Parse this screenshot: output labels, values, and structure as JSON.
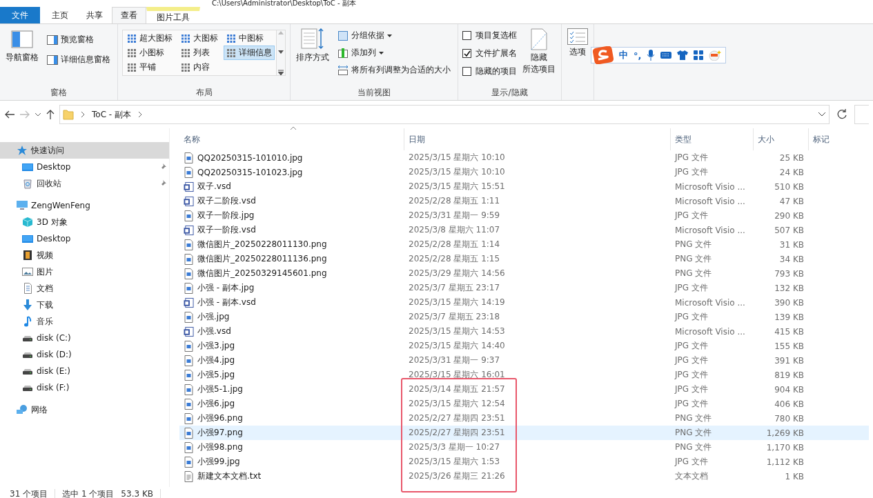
{
  "window": {
    "title": "C:\\Users\\Administrator\\Desktop\\ToC - 副本"
  },
  "ribbon_tabs": [
    {
      "label": "文件",
      "kind": "file",
      "selected": false
    },
    {
      "label": "主页",
      "kind": "tab",
      "selected": false
    },
    {
      "label": "共享",
      "kind": "tab",
      "selected": false
    },
    {
      "label": "查看",
      "kind": "tab",
      "selected": true
    },
    {
      "label": "图片工具",
      "kind": "context",
      "selected": false
    }
  ],
  "ribbon": {
    "pane_group": {
      "label": "窗格",
      "nav_pane": "导航窗格",
      "preview_pane": "预览窗格",
      "details_pane": "详细信息窗格"
    },
    "layout_group": {
      "label": "布局",
      "options": [
        {
          "label": "超大图标",
          "selected": false
        },
        {
          "label": "大图标",
          "selected": false
        },
        {
          "label": "中图标",
          "selected": false
        },
        {
          "label": "小图标",
          "selected": false
        },
        {
          "label": "列表",
          "selected": false
        },
        {
          "label": "详细信息",
          "selected": true
        },
        {
          "label": "平铺",
          "selected": false
        },
        {
          "label": "内容",
          "selected": false
        }
      ]
    },
    "view_group": {
      "label": "当前视图",
      "sort": "排序方式",
      "group_by": "分组依据",
      "add_column": "添加列",
      "fit_columns": "将所有列调整为合适的大小"
    },
    "show_group": {
      "label": "显示/隐藏",
      "checkboxes": [
        {
          "label": "项目复选框",
          "checked": false
        },
        {
          "label": "文件扩展名",
          "checked": true
        },
        {
          "label": "隐藏的项目",
          "checked": false
        }
      ],
      "hide_selected": [
        "隐藏",
        "所选项目"
      ]
    },
    "options": "选项"
  },
  "ime_toolbar": {
    "mode": "中",
    "punct": "°,"
  },
  "address_bar": {
    "path": [
      "ToC - 副本"
    ]
  },
  "sidebar": {
    "items": [
      {
        "label": "快速访问",
        "kind": "star",
        "selected": true,
        "children": [
          {
            "label": "Desktop",
            "kind": "desktop",
            "selected": false,
            "pinned": true
          },
          {
            "label": "回收站",
            "kind": "recycle",
            "selected": false,
            "pinned": true
          }
        ]
      },
      {
        "label": "ZengWenFeng",
        "kind": "pc",
        "selected": false,
        "children": [
          {
            "label": "3D 对象",
            "kind": "cube",
            "selected": false,
            "pinned": false
          },
          {
            "label": "Desktop",
            "kind": "desktop",
            "selected": false,
            "pinned": false
          },
          {
            "label": "视频",
            "kind": "video",
            "selected": false,
            "pinned": false
          },
          {
            "label": "图片",
            "kind": "pictures",
            "selected": false,
            "pinned": false
          },
          {
            "label": "文档",
            "kind": "docs",
            "selected": false,
            "pinned": false
          },
          {
            "label": "下载",
            "kind": "download",
            "selected": false,
            "pinned": false
          },
          {
            "label": "音乐",
            "kind": "music",
            "selected": false,
            "pinned": false
          },
          {
            "label": "disk (C:)",
            "kind": "drive",
            "selected": false,
            "pinned": false
          },
          {
            "label": "disk (D:)",
            "kind": "drive",
            "selected": false,
            "pinned": false
          },
          {
            "label": "disk (E:)",
            "kind": "drive",
            "selected": false,
            "pinned": false
          },
          {
            "label": "disk (F:)",
            "kind": "drive",
            "selected": false,
            "pinned": false
          }
        ]
      },
      {
        "label": "网络",
        "kind": "network",
        "selected": false
      }
    ]
  },
  "table": {
    "columns": [
      "名称",
      "日期",
      "类型",
      "大小",
      "标记"
    ],
    "rows": [
      {
        "name": "QQ20250315-101010.jpg",
        "kind": "image",
        "date": "2025/3/15 星期六 10:10",
        "type": "JPG 文件",
        "size": "25 KB",
        "selected": false
      },
      {
        "name": "QQ20250315-101023.jpg",
        "kind": "image",
        "date": "2025/3/15 星期六 10:10",
        "type": "JPG 文件",
        "size": "24 KB",
        "selected": false
      },
      {
        "name": "双子.vsd",
        "kind": "visio",
        "date": "2025/3/15 星期六 15:51",
        "type": "Microsoft Visio ...",
        "size": "510 KB",
        "selected": false
      },
      {
        "name": "双子二阶段.vsd",
        "kind": "visio",
        "date": "2025/2/28 星期五 1:11",
        "type": "Microsoft Visio ...",
        "size": "47 KB",
        "selected": false
      },
      {
        "name": "双子一阶段.jpg",
        "kind": "image",
        "date": "2025/3/31 星期一 9:59",
        "type": "JPG 文件",
        "size": "290 KB",
        "selected": false
      },
      {
        "name": "双子一阶段.vsd",
        "kind": "visio",
        "date": "2025/3/8 星期六 11:07",
        "type": "Microsoft Visio ...",
        "size": "507 KB",
        "selected": false
      },
      {
        "name": "微信图片_20250228011130.png",
        "kind": "image",
        "date": "2025/2/28 星期五 1:14",
        "type": "PNG 文件",
        "size": "31 KB",
        "selected": false
      },
      {
        "name": "微信图片_20250228011136.png",
        "kind": "image",
        "date": "2025/2/28 星期五 1:15",
        "type": "PNG 文件",
        "size": "34 KB",
        "selected": false
      },
      {
        "name": "微信图片_20250329145601.png",
        "kind": "image",
        "date": "2025/3/29 星期六 14:56",
        "type": "PNG 文件",
        "size": "793 KB",
        "selected": false
      },
      {
        "name": "小强 - 副本.jpg",
        "kind": "image",
        "date": "2025/3/7 星期五 23:17",
        "type": "JPG 文件",
        "size": "132 KB",
        "selected": false
      },
      {
        "name": "小强 - 副本.vsd",
        "kind": "visio",
        "date": "2025/3/15 星期六 14:19",
        "type": "Microsoft Visio ...",
        "size": "390 KB",
        "selected": false
      },
      {
        "name": "小强.jpg",
        "kind": "image",
        "date": "2025/3/7 星期五 23:18",
        "type": "JPG 文件",
        "size": "139 KB",
        "selected": false
      },
      {
        "name": "小强.vsd",
        "kind": "visio",
        "date": "2025/3/15 星期六 14:53",
        "type": "Microsoft Visio ...",
        "size": "415 KB",
        "selected": false
      },
      {
        "name": "小强3.jpg",
        "kind": "image",
        "date": "2025/3/15 星期六 14:40",
        "type": "JPG 文件",
        "size": "155 KB",
        "selected": false
      },
      {
        "name": "小强4.jpg",
        "kind": "image",
        "date": "2025/3/31 星期一 9:37",
        "type": "JPG 文件",
        "size": "391 KB",
        "selected": false
      },
      {
        "name": "小强5.jpg",
        "kind": "image",
        "date": "2025/3/15 星期六 16:01",
        "type": "JPG 文件",
        "size": "819 KB",
        "selected": false
      },
      {
        "name": "小强5-1.jpg",
        "kind": "image",
        "date": "2025/3/14 星期五 21:57",
        "type": "JPG 文件",
        "size": "904 KB",
        "selected": false
      },
      {
        "name": "小强6.jpg",
        "kind": "image",
        "date": "2025/3/15 星期六 12:54",
        "type": "JPG 文件",
        "size": "406 KB",
        "selected": false
      },
      {
        "name": "小强96.png",
        "kind": "image",
        "date": "2025/2/27 星期四 23:51",
        "type": "PNG 文件",
        "size": "780 KB",
        "selected": false
      },
      {
        "name": "小强97.png",
        "kind": "image",
        "date": "2025/2/27 星期四 23:51",
        "type": "PNG 文件",
        "size": "1,269 KB",
        "selected": true
      },
      {
        "name": "小强98.png",
        "kind": "image",
        "date": "2025/3/3 星期一 10:27",
        "type": "PNG 文件",
        "size": "1,170 KB",
        "selected": false
      },
      {
        "name": "小强99.jpg",
        "kind": "image",
        "date": "2025/3/15 星期六 1:53",
        "type": "JPG 文件",
        "size": "1,112 KB",
        "selected": false
      },
      {
        "name": "新建文本文档.txt",
        "kind": "text",
        "date": "2025/3/26 星期三 21:26",
        "type": "文本文档",
        "size": "1 KB",
        "selected": false
      }
    ]
  },
  "status_bar": {
    "count": "31 个项目",
    "selection": "选中 1 个项目",
    "size": "53.3 KB"
  }
}
